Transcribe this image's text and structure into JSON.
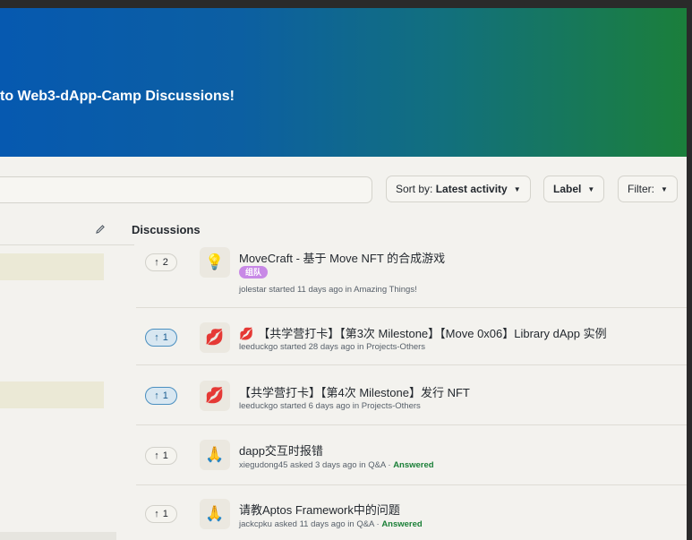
{
  "banner": {
    "title": "to Web3-dApp-Camp Discussions!"
  },
  "toolbar": {
    "sort_prefix": "Sort by: ",
    "sort_value": "Latest activity",
    "label_button": "Label",
    "filter_button": "Filter:"
  },
  "sidebar": {
    "edit_icon": "pencil-icon"
  },
  "discussions": {
    "heading": "Discussions",
    "items": [
      {
        "votes": "2",
        "icon": "💡",
        "title": "MoveCraft - 基于 Move NFT 的合成游戏",
        "badge": "组队",
        "meta": "jolestar started 11 days ago in Amazing Things!",
        "answered": ""
      },
      {
        "votes": "1",
        "icon": "💋",
        "title_prefix": "💋",
        "title": "【共学营打卡】【第3次 Milestone】【Move 0x06】Library dApp 实例",
        "meta": "leeduckgo started 28 days ago in Projects-Others",
        "answered": ""
      },
      {
        "votes": "1",
        "icon": "💋",
        "title": "【共学营打卡】【第4次 Milestone】发行 NFT",
        "meta": "leeduckgo started 6 days ago in Projects-Others",
        "answered": ""
      },
      {
        "votes": "1",
        "icon": "🙏",
        "title": "dapp交互时报错",
        "meta": "xiegudong45 asked 3 days ago in Q&A · ",
        "answered": "Answered"
      },
      {
        "votes": "1",
        "icon": "🙏",
        "title": "请教Aptos Framework中的问题",
        "meta": "jackcpku asked 11 days ago in Q&A · ",
        "answered": "Answered"
      }
    ]
  },
  "colors": {
    "accent_blue": "#0659b0",
    "accent_green": "#1b7f3b",
    "badge": "#c889e6",
    "answered": "#1a7f37"
  }
}
